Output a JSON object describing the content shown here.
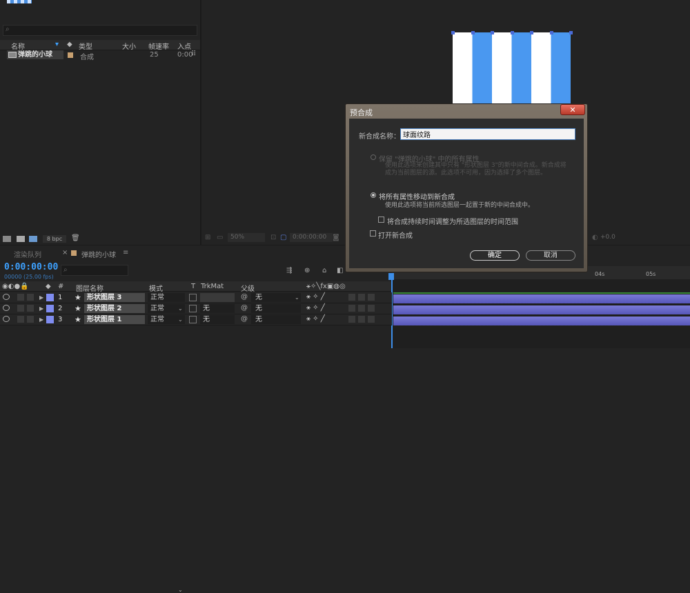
{
  "project": {
    "columns": [
      "名称",
      "类型",
      "大小",
      "帧速率",
      "入点"
    ],
    "item": {
      "name": "弹跳的小球",
      "type": "合成",
      "fps": "25",
      "in_point": "0:00"
    },
    "bpc": "8 bpc"
  },
  "viewer": {
    "zoom": "50%",
    "time": "0:00:00:00",
    "offset": "+0.0"
  },
  "timeline": {
    "render_queue_tab": "渲染队列",
    "comp_tab": "弹跳的小球",
    "timecode": "0:00:00:00",
    "fps_line": "00000 (25.00 fps)",
    "columns": {
      "num": "#",
      "layer_name": "图层名称",
      "mode": "模式",
      "t": "T",
      "trkmat": "TrkMat",
      "parent": "父级"
    },
    "layers": [
      {
        "num": "1",
        "name": "形状图层 3",
        "mode": "正常",
        "trkmat": "",
        "parent": "无"
      },
      {
        "num": "2",
        "name": "形状图层 2",
        "mode": "正常",
        "trkmat": "无",
        "parent": "无"
      },
      {
        "num": "3",
        "name": "形状图层 1",
        "mode": "正常",
        "trkmat": "无",
        "parent": "无"
      }
    ],
    "ruler": [
      "04s",
      "05s"
    ]
  },
  "dialog": {
    "title": "预合成",
    "close": "✕",
    "name_label": "新合成名称：",
    "name_value": "球面纹路",
    "option1_label": "保留 \"弹跳的小球\" 中的所有属性",
    "option1_desc": "使用此选项来创建其中只有 \"形状图层 3\"的新中间合成。新合成将成为当前图层的源。此选项不可用，因为选择了多个图层。",
    "option2_label": "将所有属性移动到新合成",
    "option2_desc": "使用此选项将当前所选图层一起置于新的中间合成中。",
    "checkbox1_label": "将合成持续时间调整为所选图层的时间范围",
    "checkbox2_label": "打开新合成",
    "ok_label": "确定",
    "cancel_label": "取消"
  },
  "colors": {
    "accent": "#3da1ff",
    "layer_label": "#7f8cf0",
    "stripe_blue": "#4a98f0"
  }
}
